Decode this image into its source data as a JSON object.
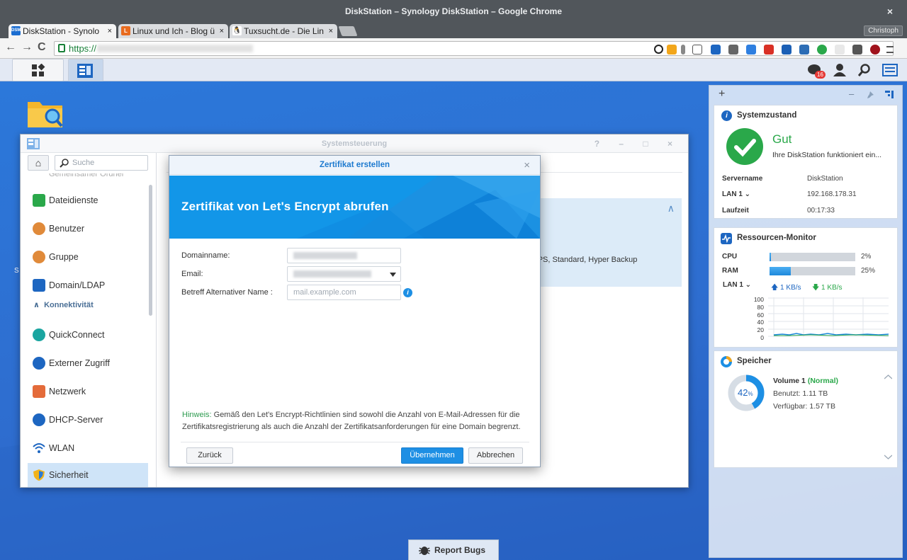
{
  "browser": {
    "window_title": "DiskStation – Synology DiskStation – Google Chrome",
    "close_glyph": "×",
    "tabs": [
      {
        "label": "DiskStation - Synolo",
        "favicon": "DSM",
        "favicon_color": "#1b6dd1"
      },
      {
        "label": "Linux und Ich - Blog ü",
        "favicon": "L",
        "favicon_color": "#e86b1f"
      },
      {
        "label": "Tuxsucht.de - Die Lin",
        "favicon": "penguin",
        "favicon_color": "#333333"
      }
    ],
    "tab_close": "×",
    "profile": "Christoph",
    "url_protocol": "https://",
    "nav": {
      "back": "←",
      "forward": "→",
      "reload": "C"
    }
  },
  "dsm": {
    "taskbar_badge": "16"
  },
  "window": {
    "title": "Systemsteuerung",
    "controls": "? – □ ×",
    "search_placeholder": "Suche",
    "sidebar_partial": "Gemeinsamer Ordner",
    "sidebar": [
      {
        "label": "Dateidienste",
        "icon": "file-services-icon",
        "color": "#2aa84a"
      },
      {
        "label": "Benutzer",
        "icon": "user-icon",
        "color": "#e08a3a"
      },
      {
        "label": "Gruppe",
        "icon": "group-icon",
        "color": "#e08a3a"
      },
      {
        "label": "Domain/LDAP",
        "icon": "domain-icon",
        "color": "#1d66c1"
      }
    ],
    "group_label": "Konnektivität",
    "group_arrow": "∧",
    "sidebar2": [
      {
        "label": "QuickConnect",
        "icon": "quickconnect-icon",
        "color": "#1aa5a0"
      },
      {
        "label": "Externer Zugriff",
        "icon": "globe-icon",
        "color": "#1d66c1"
      },
      {
        "label": "Netzwerk",
        "icon": "home-network-icon",
        "color": "#e46b3a"
      },
      {
        "label": "DHCP-Server",
        "icon": "dhcp-icon",
        "color": "#1d66c1"
      },
      {
        "label": "WLAN",
        "icon": "wifi-icon",
        "color": "#1d66c1"
      },
      {
        "label": "Sicherheit",
        "icon": "shield-icon",
        "color": "#f2b31b"
      }
    ],
    "content_text": "TPS, Standard, Hyper Backup",
    "content_side_label": "S",
    "content_chevron": "∧"
  },
  "dialog": {
    "title": "Zertifikat erstellen",
    "close": "×",
    "heading": "Zertifikat von Let's Encrypt abrufen",
    "fields": {
      "domain_label": "Domainname:",
      "email_label": "Email:",
      "alt_label": "Betreff Alternativer Name :",
      "alt_placeholder": "mail.example.com"
    },
    "info_glyph": "i",
    "hint_prefix": "Hinweis:",
    "hint_text": " Gemäß den Let's Encrypt-Richtlinien sind sowohl die Anzahl von E-Mail-Adressen für die Zertifikatsregistrierung als auch die Anzahl der Zertifikatsanforderungen für eine Domain begrenzt.",
    "buttons": {
      "back": "Zurück",
      "apply": "Übernehmen",
      "cancel": "Abbrechen"
    }
  },
  "widgets": {
    "add": "+",
    "top_controls": "–",
    "system": {
      "title": "Systemzustand",
      "status": "Gut",
      "status_color": "#2aa84a",
      "message": "Ihre DiskStation funktioniert ein...",
      "rows": [
        {
          "key": "Servername",
          "value": "DiskStation"
        },
        {
          "key": "LAN 1 ⌄",
          "value": "192.168.178.31"
        },
        {
          "key": "Laufzeit",
          "value": "00:17:33"
        }
      ]
    },
    "resource": {
      "title": "Ressourcen-Monitor",
      "cpu_label": "CPU",
      "cpu_value": "2%",
      "cpu_fraction": 0.02,
      "ram_label": "RAM",
      "ram_value": "25%",
      "ram_fraction": 0.25,
      "lan_label": "LAN 1 ⌄",
      "upload": "🡅 1 KB/s",
      "download": "🡇 1 KB/s",
      "y_ticks": [
        "100",
        "80",
        "60",
        "40",
        "20",
        "0"
      ]
    },
    "storage": {
      "title": "Speicher",
      "percent": "42",
      "percent_sign": "%",
      "fraction": 0.42,
      "volume": "Volume 1",
      "volume_status": "(Normal)",
      "used": "Benutzt: 1.11 TB",
      "free": "Verfügbar: 1.57 TB"
    }
  },
  "report_bugs": "Report Bugs"
}
